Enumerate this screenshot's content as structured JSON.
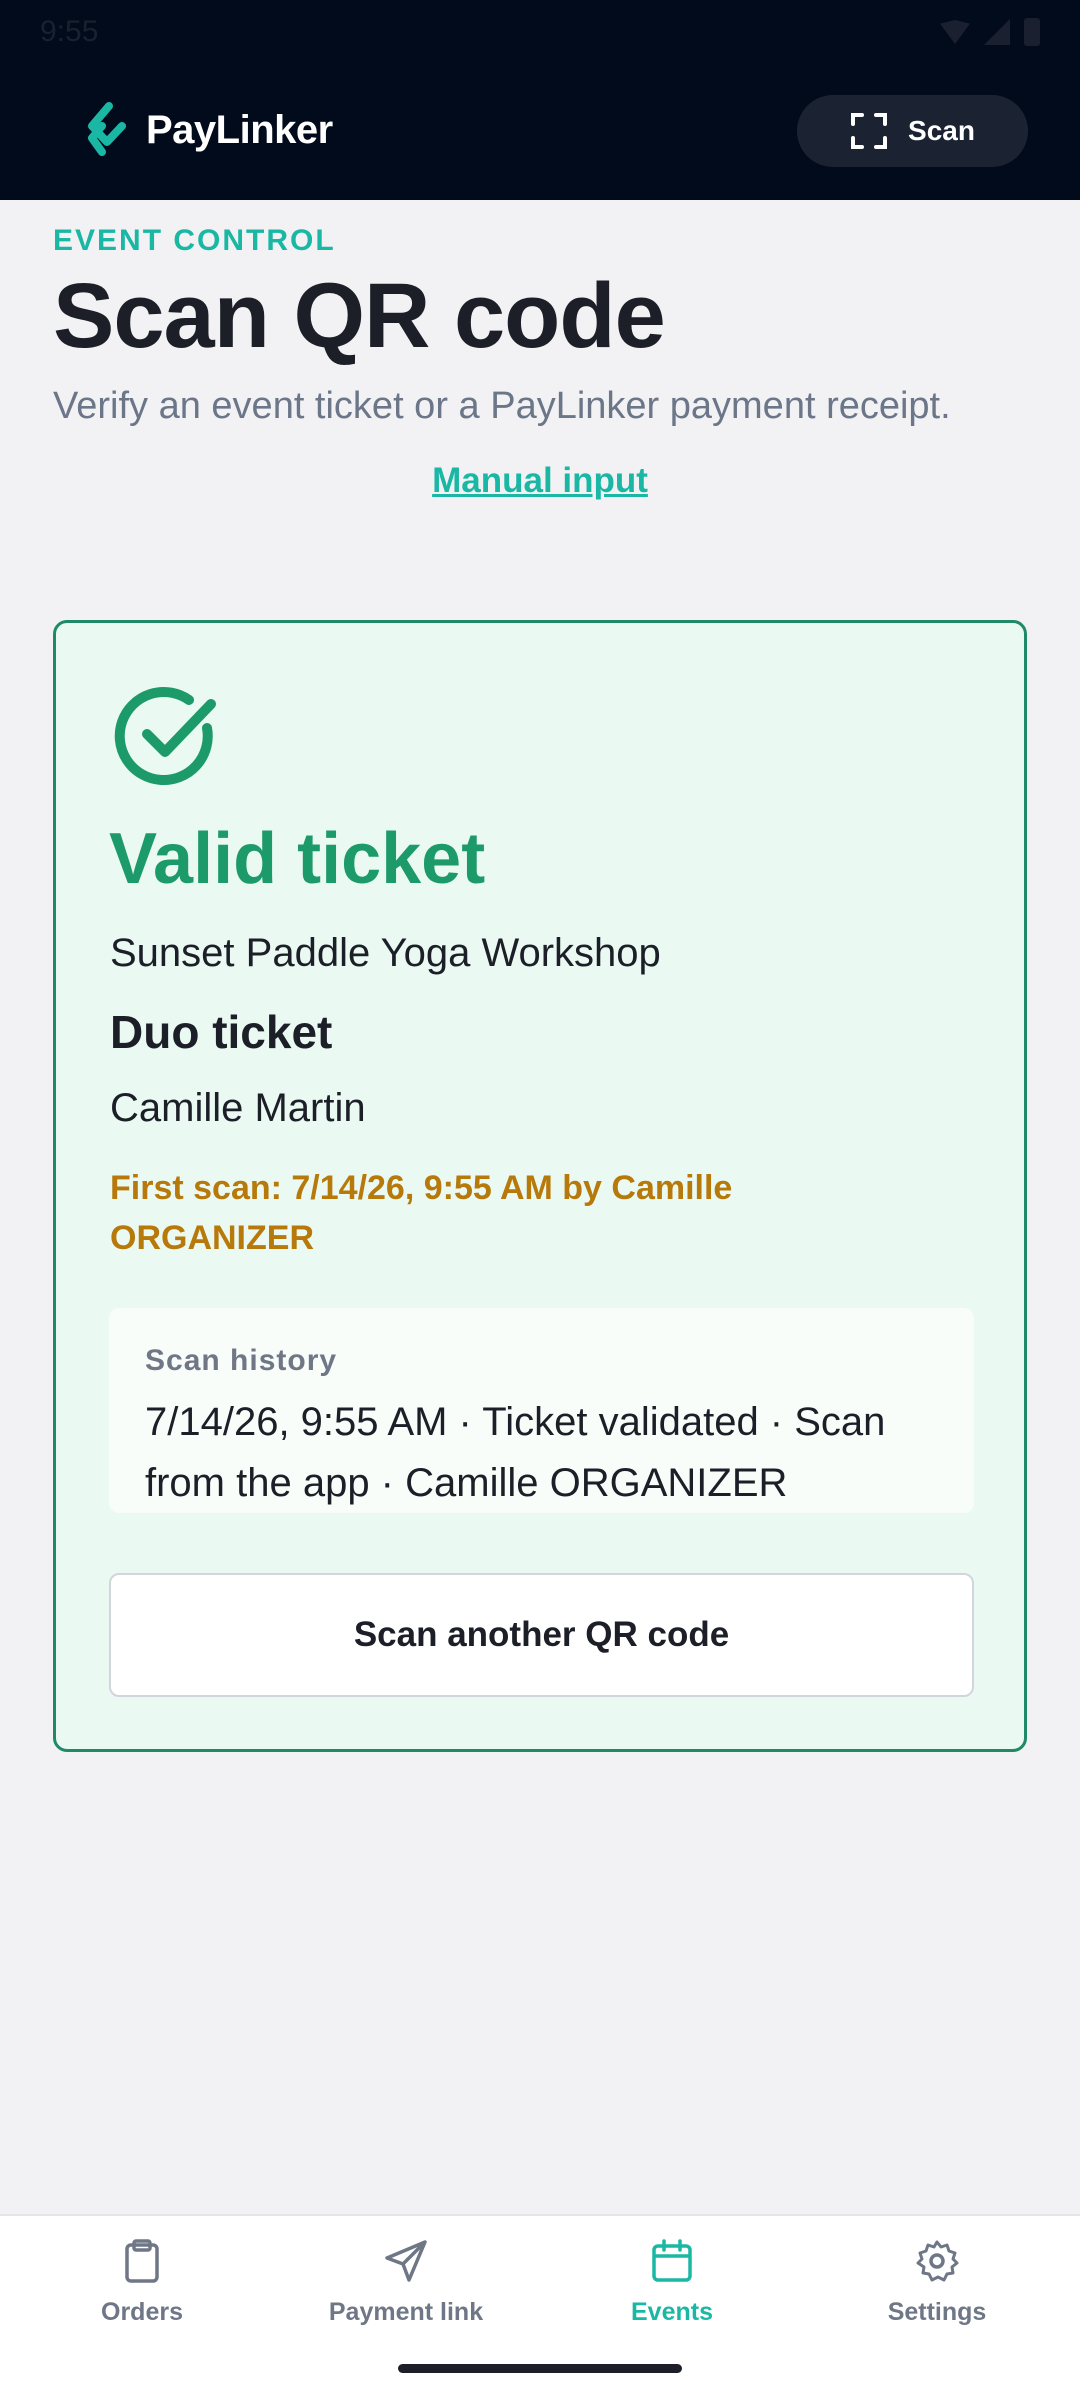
{
  "status_bar": {
    "time": "9:55"
  },
  "header": {
    "brand": "PayLinker",
    "scan_button": "Scan"
  },
  "page": {
    "eyebrow": "EVENT CONTROL",
    "title": "Scan QR code",
    "subtitle": "Verify an event ticket or a PayLinker payment receipt.",
    "manual_input_link": "Manual input"
  },
  "result": {
    "status_title": "Valid ticket",
    "event_name": "Sunset Paddle Yoga Workshop",
    "ticket_type": "Duo ticket",
    "holder": "Camille Martin",
    "first_scan": "First scan: 7/14/26, 9:55 AM by Camille ORGANIZER",
    "history_label": "Scan history",
    "history_entries": [
      "7/14/26, 9:55 AM · Ticket validated · Scan from the app · Camille ORGANIZER"
    ],
    "scan_another_button": "Scan another QR code",
    "status_color": "#1d9a69"
  },
  "bottom_nav": {
    "items": [
      {
        "label": "Orders",
        "icon": "clipboard-icon",
        "active": false
      },
      {
        "label": "Payment link",
        "icon": "send-icon",
        "active": false
      },
      {
        "label": "Events",
        "icon": "calendar-icon",
        "active": true
      },
      {
        "label": "Settings",
        "icon": "gear-icon",
        "active": false
      }
    ]
  },
  "colors": {
    "accent": "#1ab8a4",
    "header_bg": "#020b1c",
    "warning": "#b7790a"
  }
}
